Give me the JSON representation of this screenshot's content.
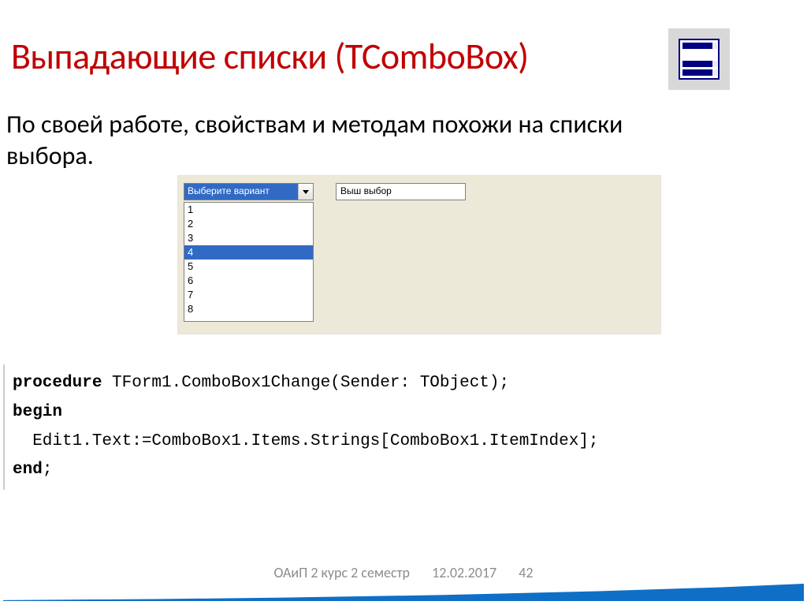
{
  "title": "Выпадающие списки (TComboBox)",
  "subtitle": "По своей работе, свойствам и методам похожи на списки выбора.",
  "panel": {
    "combo_text": "Выберите вариант",
    "edit_text": "Выш выбор",
    "items": [
      "1",
      "2",
      "3",
      "4",
      "5",
      "6",
      "7",
      "8"
    ],
    "selected_index": 3
  },
  "code": {
    "line1_kw": "procedure",
    "line1_rest": " TForm1.ComboBox1Change(Sender: TObject);",
    "line2": "begin",
    "line3": "  Edit1.Text:=ComboBox1.Items.Strings[ComboBox1.ItemIndex];",
    "line4_kw": "end",
    "line4_rest": ";"
  },
  "footer": {
    "course": "ОАиП 2 курс 2 семестр",
    "date": "12.02.2017",
    "page": "42"
  }
}
